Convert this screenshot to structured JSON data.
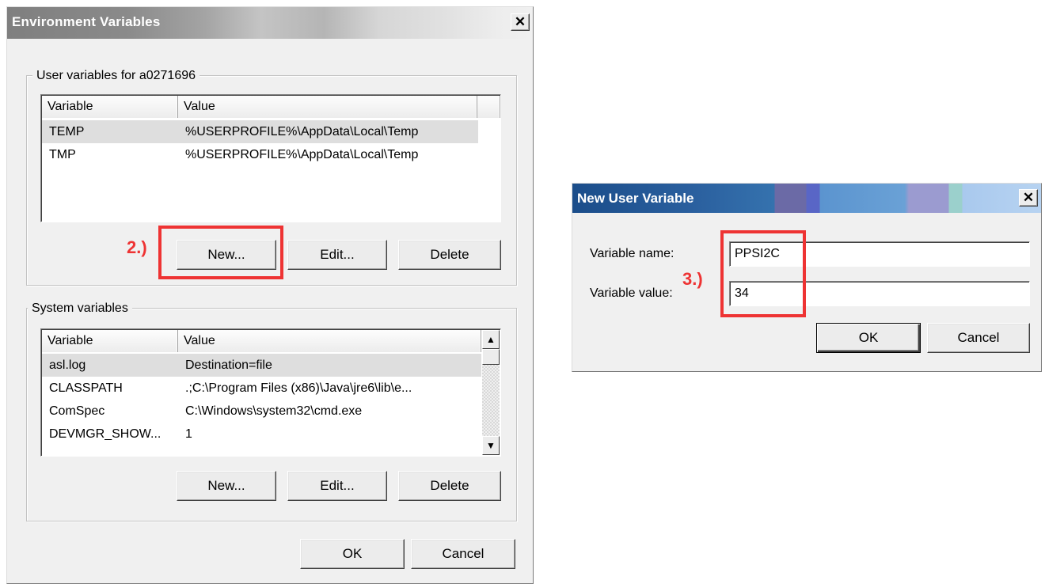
{
  "env_dialog": {
    "title": "Environment Variables",
    "close_glyph": "✕",
    "user_group": {
      "legend": "User variables for a0271696",
      "columns": [
        "Variable",
        "Value"
      ],
      "rows": [
        {
          "variable": "TEMP",
          "value": "%USERPROFILE%\\AppData\\Local\\Temp"
        },
        {
          "variable": "TMP",
          "value": "%USERPROFILE%\\AppData\\Local\\Temp"
        }
      ],
      "new_label": "New...",
      "edit_label": "Edit...",
      "delete_label": "Delete"
    },
    "system_group": {
      "legend": "System variables",
      "columns": [
        "Variable",
        "Value"
      ],
      "rows": [
        {
          "variable": "asl.log",
          "value": "Destination=file"
        },
        {
          "variable": "CLASSPATH",
          "value": ".;C:\\Program Files (x86)\\Java\\jre6\\lib\\e..."
        },
        {
          "variable": "ComSpec",
          "value": "C:\\Windows\\system32\\cmd.exe"
        },
        {
          "variable": "DEVMGR_SHOW...",
          "value": "1"
        }
      ],
      "new_label": "New...",
      "edit_label": "Edit...",
      "delete_label": "Delete"
    },
    "ok_label": "OK",
    "cancel_label": "Cancel"
  },
  "annotations": {
    "step2": "2.)",
    "step3": "3.)",
    "highlight_color": "#ee3333"
  },
  "new_var_dialog": {
    "title": "New User Variable",
    "close_glyph": "✕",
    "name_label": "Variable name:",
    "name_value": "PPSI2C",
    "value_label": "Variable value:",
    "value_value": "34",
    "ok_label": "OK",
    "cancel_label": "Cancel"
  },
  "icons": {
    "scroll_up": "▲",
    "scroll_down": "▼"
  }
}
